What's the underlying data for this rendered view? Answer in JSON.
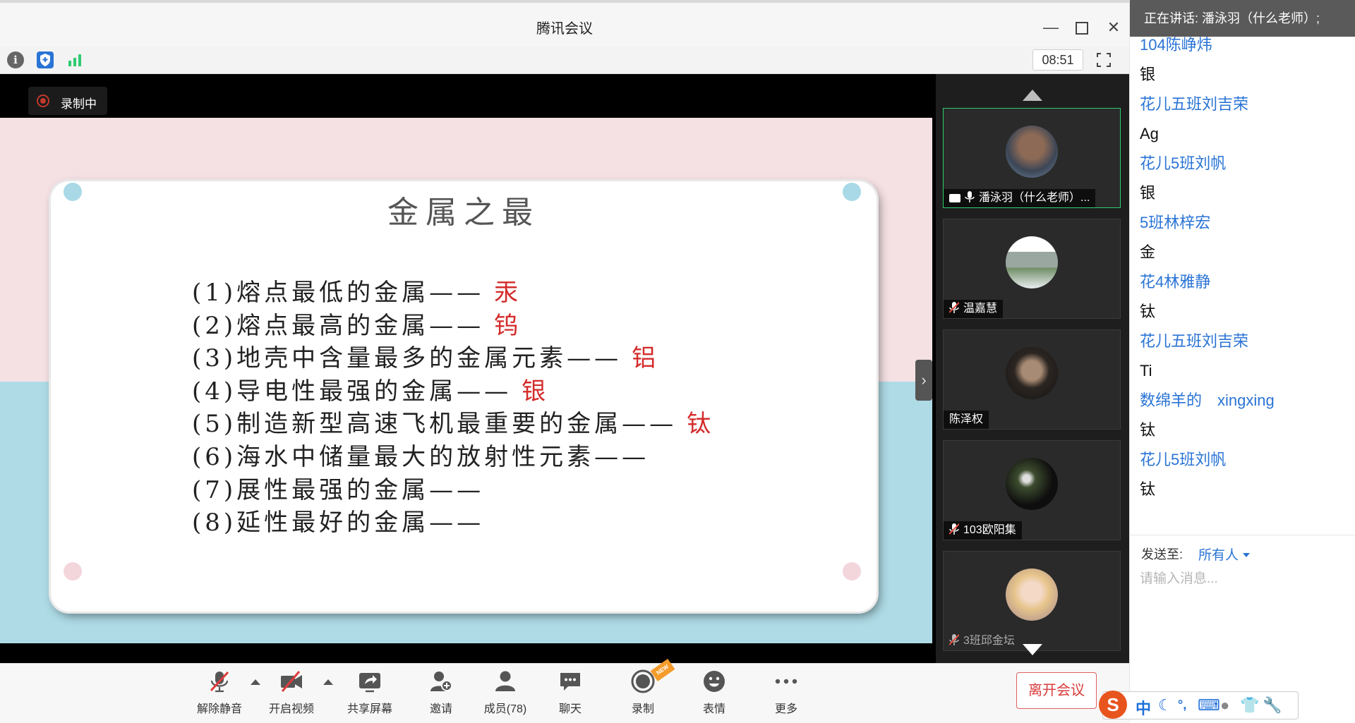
{
  "window": {
    "title": "腾讯会议",
    "timer": "08:51"
  },
  "stage": {
    "recording_label": "录制中"
  },
  "slide": {
    "title": "金属之最",
    "lines": [
      {
        "text": "(1)熔点最低的金属——",
        "answer": "汞"
      },
      {
        "text": "(2)熔点最高的金属——",
        "answer": "钨"
      },
      {
        "text": "(3)地壳中含量最多的金属元素——",
        "answer": "铝"
      },
      {
        "text": "(4)导电性最强的金属——",
        "answer": "银"
      },
      {
        "text": "(5)制造新型高速飞机最重要的金属——",
        "answer": "钛"
      },
      {
        "text": "(6)海水中储量最大的放射性元素——",
        "answer": ""
      },
      {
        "text": "(7)展性最强的金属——",
        "answer": ""
      },
      {
        "text": "(8)延性最好的金属——",
        "answer": ""
      }
    ]
  },
  "participants": [
    {
      "name": "潘泳羽（什么老师）...",
      "active": true
    },
    {
      "name": "温嘉慧",
      "active": false
    },
    {
      "name": "陈泽权",
      "active": false
    },
    {
      "name": "103欧阳集",
      "active": false
    },
    {
      "name": "3班邱金坛",
      "active": false
    }
  ],
  "bottombar": {
    "unmute": "解除静音",
    "video": "开启视频",
    "share": "共享屏幕",
    "invite": "邀请",
    "members": "成员(78)",
    "chat": "聊天",
    "record": "录制",
    "record_badge": "NEW",
    "reactions": "表情",
    "more": "更多",
    "leave": "离开会议"
  },
  "chat": {
    "speaking": "正在讲话: 潘泳羽（什么老师）;",
    "messages": [
      {
        "sender": "104陈峥炜",
        "text": "银"
      },
      {
        "sender": "花儿五班刘吉荣",
        "text": "Ag"
      },
      {
        "sender": "花儿5班刘帆",
        "text": "银"
      },
      {
        "sender": "5班林梓宏",
        "text": "金"
      },
      {
        "sender": "花4林雅静",
        "text": "钛"
      },
      {
        "sender": "花儿五班刘吉荣",
        "text": "Ti"
      },
      {
        "sender": "数绵羊的　xingxing",
        "text": "钛"
      },
      {
        "sender": "花儿5班刘帆",
        "text": "钛"
      }
    ],
    "send_to_label": "发送至:",
    "send_to_value": "所有人",
    "input_placeholder": "请输入消息..."
  },
  "ime": {
    "mode": "中"
  },
  "colors": {
    "accent": "#2a74d5",
    "danger": "#d83b3b",
    "answer_red": "#d42b2b",
    "active_border": "#2ecc71"
  }
}
